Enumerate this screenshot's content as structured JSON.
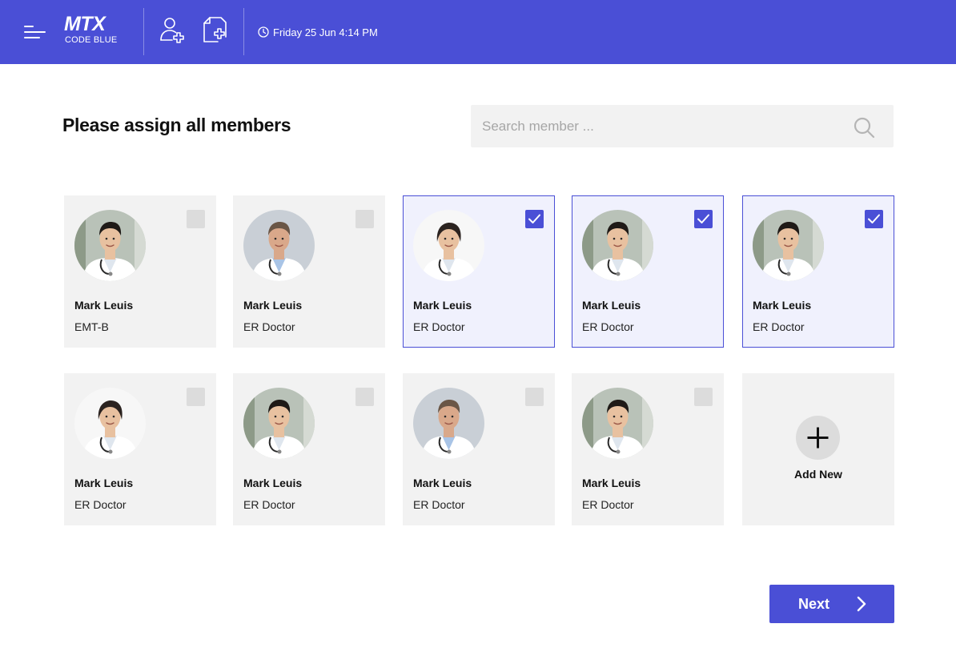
{
  "header": {
    "logo_text": "MTX",
    "logo_subtitle": "CODE BLUE",
    "datetime": "Friday 25 Jun 4:14 PM",
    "brand_color": "#4a4fd6"
  },
  "main": {
    "title": "Please assign all members",
    "search_placeholder": "Search member ...",
    "search_value": ""
  },
  "members": [
    {
      "name": "Mark Leuis",
      "role": "EMT-B",
      "selected": false,
      "photo": "asian-male-doctor"
    },
    {
      "name": "Mark Leuis",
      "role": "ER Doctor",
      "selected": false,
      "photo": "caucasian-male-doctor"
    },
    {
      "name": "Mark Leuis",
      "role": "ER Doctor",
      "selected": true,
      "photo": "asian-female-doctor"
    },
    {
      "name": "Mark Leuis",
      "role": "ER Doctor",
      "selected": true,
      "photo": "asian-male-doctor"
    },
    {
      "name": "Mark Leuis",
      "role": "ER Doctor",
      "selected": true,
      "photo": "asian-male-doctor"
    },
    {
      "name": "Mark Leuis",
      "role": "ER Doctor",
      "selected": false,
      "photo": "asian-female-doctor"
    },
    {
      "name": "Mark Leuis",
      "role": "ER Doctor",
      "selected": false,
      "photo": "asian-male-doctor"
    },
    {
      "name": "Mark Leuis",
      "role": "ER Doctor",
      "selected": false,
      "photo": "caucasian-male-doctor"
    },
    {
      "name": "Mark Leuis",
      "role": "ER Doctor",
      "selected": false,
      "photo": "asian-male-doctor"
    }
  ],
  "add_new_label": "Add New",
  "next_label": "Next"
}
